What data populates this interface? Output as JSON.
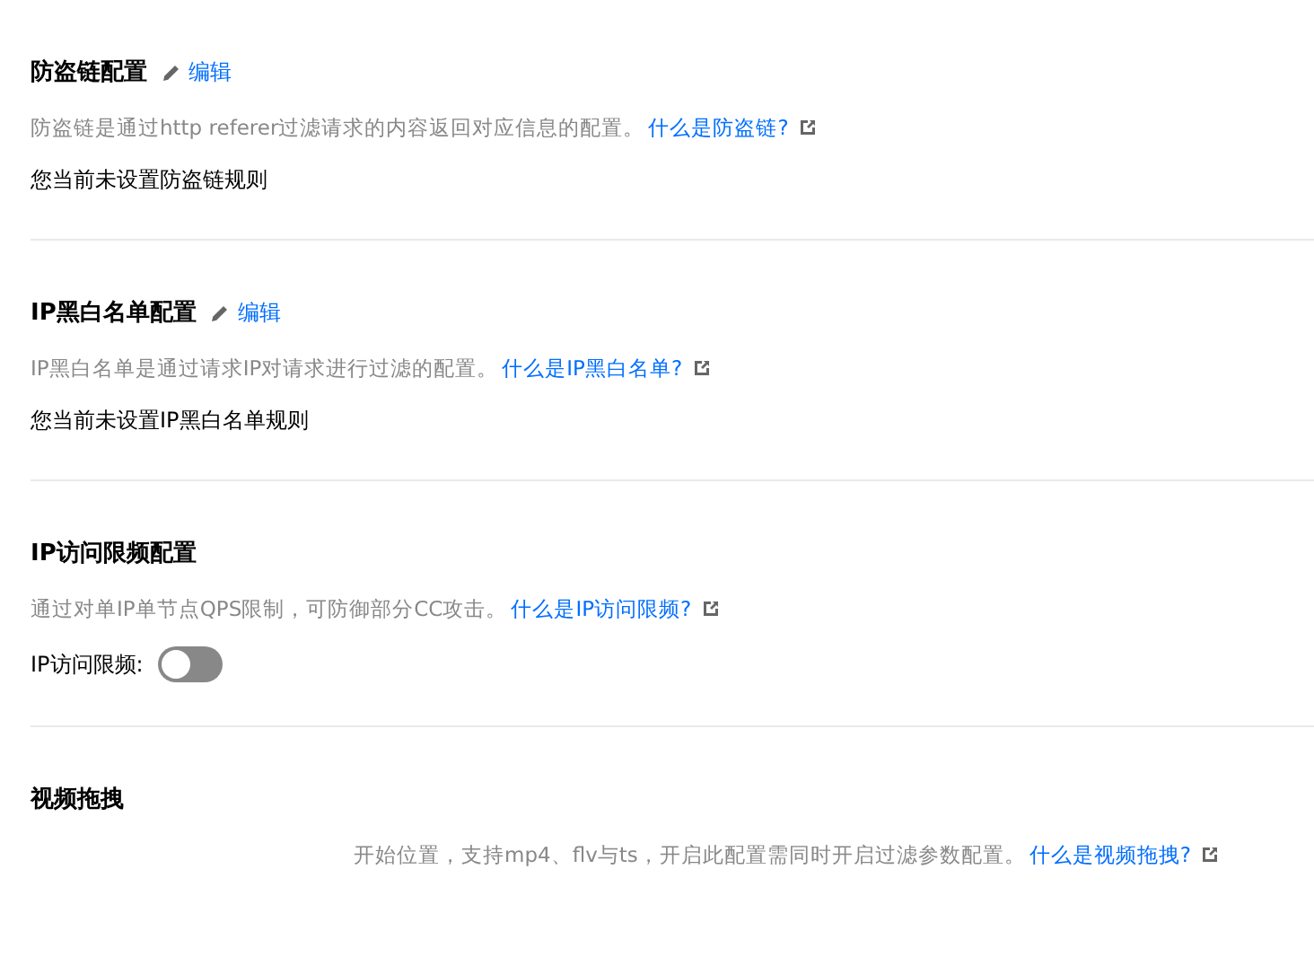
{
  "sections": [
    {
      "kind": "rule",
      "title": "防盗链配置",
      "edit": "编辑",
      "description": "防盗链是通过http referer过滤请求的内容返回对应信息的配置。",
      "help_link": "什么是防盗链?",
      "status": "您当前未设置防盗链规则"
    },
    {
      "kind": "rule",
      "title": "IP黑白名单配置",
      "edit": "编辑",
      "description": "IP黑白名单是通过请求IP对请求进行过滤的配置。",
      "help_link": "什么是IP黑白名单?",
      "status": "您当前未设置IP黑白名单规则"
    },
    {
      "kind": "toggle",
      "title": "IP访问限频配置",
      "description": "通过对单IP单节点QPS限制，可防御部分CC攻击。",
      "help_link": "什么是IP访问限频?",
      "toggle_label": "IP访问限频:",
      "on": false
    },
    {
      "kind": "obscured",
      "title": "视频拖拽",
      "description": "开始位置，支持mp4、flv与ts，开启此配置需同时开启过滤参数配置。",
      "help_link": "什么是视频拖拽?"
    }
  ]
}
